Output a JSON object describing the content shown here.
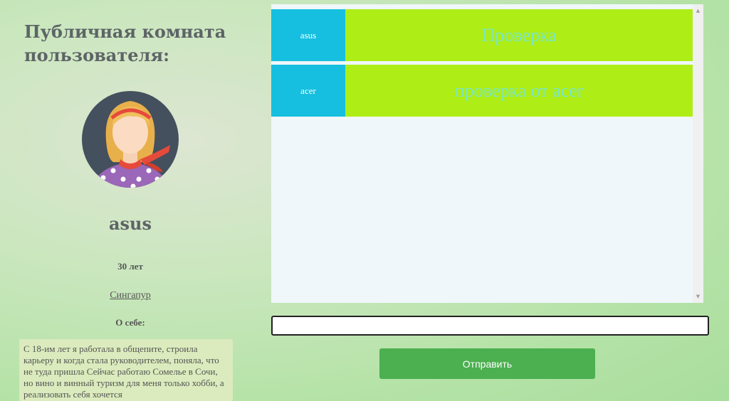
{
  "profile": {
    "title": "Публичная комната пользователя:",
    "username": "asus",
    "age": "30 лет",
    "city": "Сингапур",
    "about_label": "О себе:",
    "about_text": "С 18-им лет я работала в общепите, строила карьеру и когда стала руководителем, поняла, что не туда пришла Сейчас работаю Сомелье в Сочи, но вино и винный туризм для меня только хобби, а реализовать себя хочется"
  },
  "chat": {
    "messages": [
      {
        "author": "asus",
        "text": "Проверка"
      },
      {
        "author": "acer",
        "text": "проверка от acer"
      }
    ],
    "scroll_up_icon": "triangle-up",
    "scroll_down_icon": "triangle-down"
  },
  "composer": {
    "input_value": "",
    "input_placeholder": "",
    "send_label": "Отправить"
  },
  "colors": {
    "author_bg": "#16bfdf",
    "message_bg": "#aeed16",
    "message_text": "#7ae6c3",
    "send_button": "#4caf50",
    "chat_bg": "#eff7fb"
  }
}
